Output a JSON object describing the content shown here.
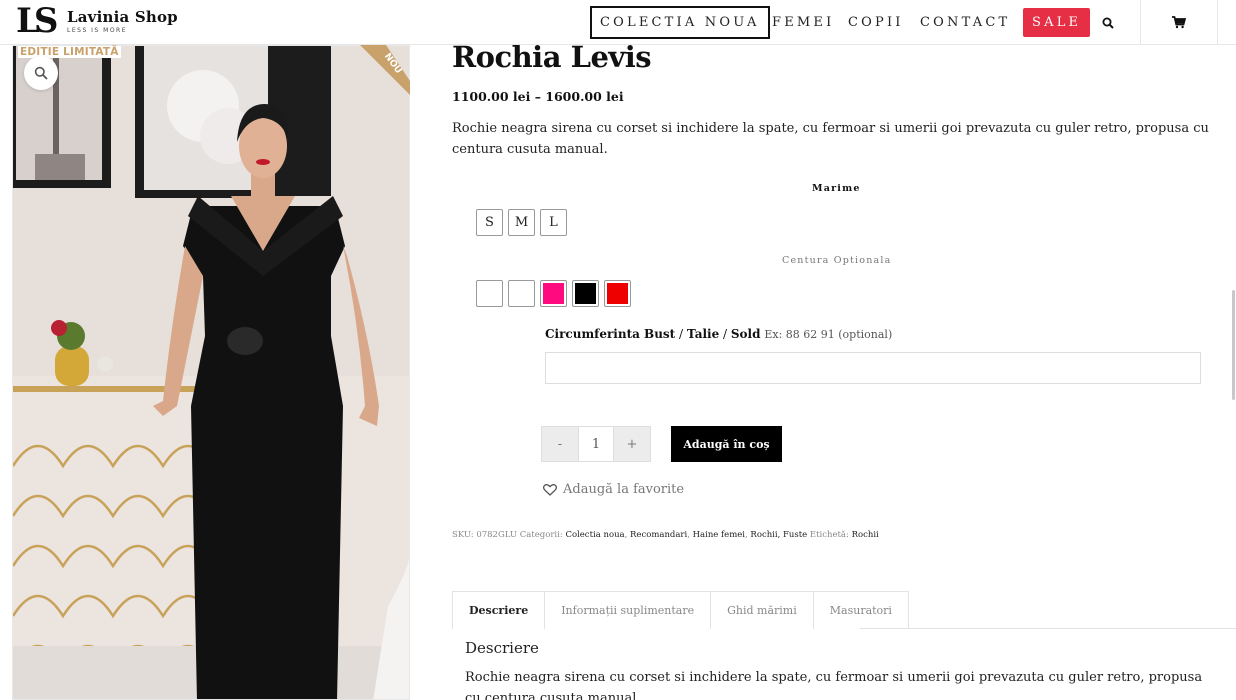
{
  "header": {
    "logo_mark": "LS",
    "logo_name": "Lavinia Shop",
    "logo_tagline": "LESS IS MORE",
    "nav": [
      {
        "label": "COLECTIA NOUA"
      },
      {
        "label": "FEMEI"
      },
      {
        "label": "COPII"
      },
      {
        "label": "CONTACT"
      },
      {
        "label": "SALE"
      }
    ],
    "icons": [
      "search-icon",
      "cart-icon"
    ],
    "sale_color": "#e62e45"
  },
  "gallery": {
    "badge_limited": "EDITIE LIMITATĂ",
    "ribbon": "NOU",
    "ribbon_color": "#c9a16b"
  },
  "product": {
    "title": "Rochia Levis",
    "price": "1100.00 lei – 1600.00 lei",
    "short_description": "Rochie neagra sirena cu corset si inchidere la spate, cu fermoar si umerii goi prevazuta cu guler retro, propusa cu centura cusuta manual.",
    "size_label": "Marime",
    "sizes": [
      "S",
      "M",
      "L"
    ],
    "belt_label": "Centura Optionala",
    "belt_colors": [
      "#ffffff",
      "#ffffff",
      "#ff0a7f",
      "#000000",
      "#ee0000"
    ],
    "measure_label_1": "Circumferinta Bust",
    "measure_label_2": "Talie",
    "measure_label_3": "Sold",
    "measure_hint": "Ex: 88 62 91 (optional)",
    "measure_value": "",
    "qty_minus": "-",
    "qty_value": "1",
    "qty_plus": "+",
    "add_to_cart": "Adaugă în coș",
    "favorite": "Adaugă la favorite"
  },
  "meta": {
    "sku_label": "SKU:",
    "sku": "0782GLU",
    "categories_label": "Categorii:",
    "categories": [
      "Colectia noua",
      "Recomandari",
      "Haine femei",
      "Rochii, Fuste"
    ],
    "tag_label": "Etichetă:",
    "tag": "Rochii"
  },
  "tabs": [
    {
      "label": "Descriere",
      "active": true
    },
    {
      "label": "Informații suplimentare",
      "active": false
    },
    {
      "label": "Ghid mărimi",
      "active": false
    },
    {
      "label": "Masuratori",
      "active": false
    }
  ],
  "description_section": {
    "title": "Descriere",
    "text": "Rochie neagra sirena cu corset si inchidere la spate, cu fermoar si umerii goi prevazuta cu guler retro, propusa cu centura cusuta manual."
  }
}
